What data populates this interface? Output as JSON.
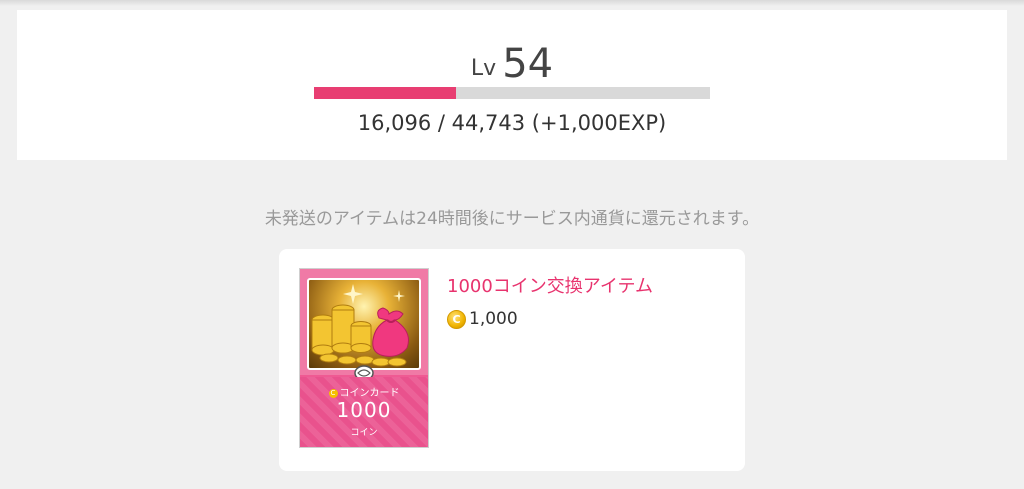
{
  "level": {
    "prefix": "Lv",
    "value": "54",
    "progress_fraction": 0.3597,
    "exp_text": "16,096 / 44,743 (+1,000EXP)"
  },
  "notice": "未発送のアイテムは24時間後にサービス内通貨に還元されます。",
  "item": {
    "title": "1000コイン交換アイテム",
    "price": "1,000",
    "coin_symbol": "C",
    "card_label": "コインカード",
    "card_amount": "1000",
    "card_unit": "コイン"
  },
  "colors": {
    "accent": "#e8336e",
    "progress_fill": "#e83e72",
    "progress_track": "#d9d9d9"
  },
  "icons": {
    "coin": "coin-icon",
    "item_thumbnail": "coin-card-icon"
  }
}
